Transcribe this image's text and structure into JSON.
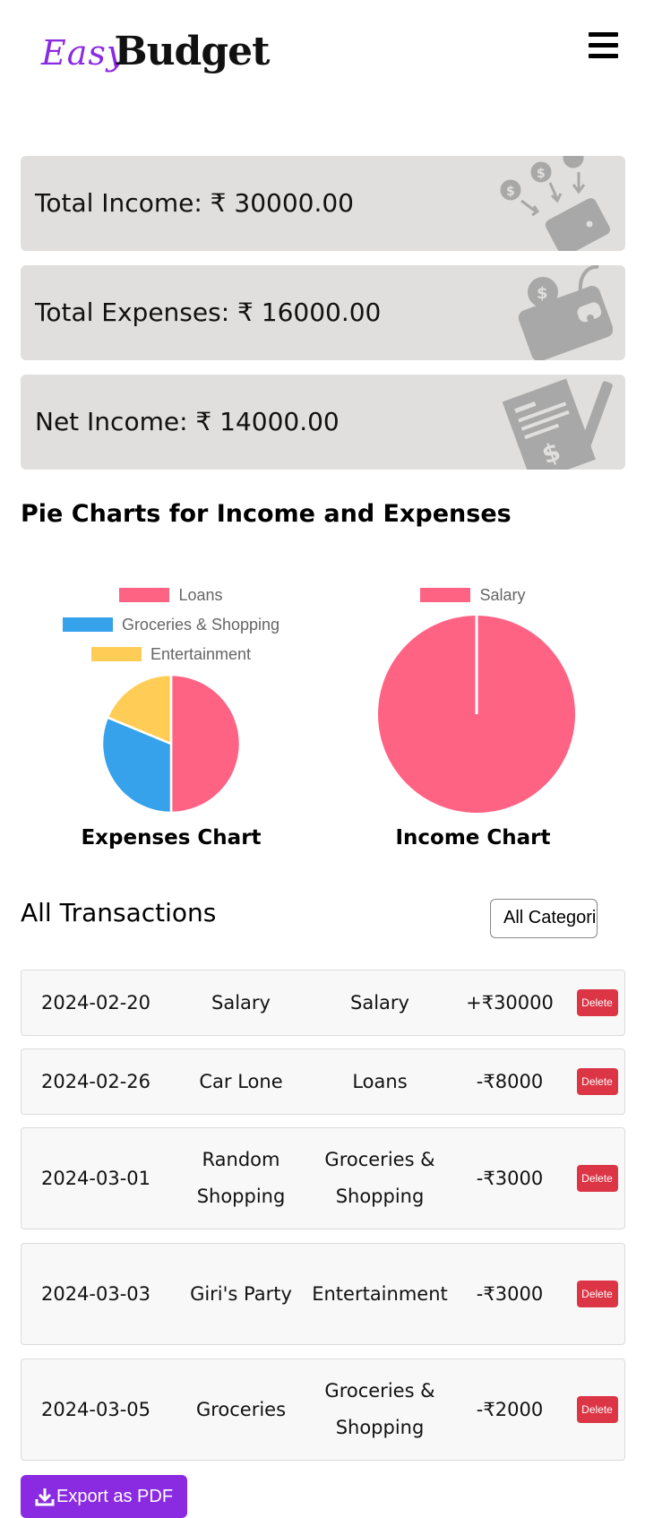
{
  "header": {
    "logo_easy": "Easy",
    "logo_budget": "Budget"
  },
  "summary": {
    "income": "Total Income: ₹ 30000.00",
    "expenses": "Total Expenses: ₹ 16000.00",
    "net": "Net Income: ₹ 14000.00"
  },
  "charts_section": {
    "title": "Pie Charts for Income and Expenses"
  },
  "chart_data": [
    {
      "type": "pie",
      "title": "Expenses Chart",
      "categories": [
        "Loans",
        "Groceries & Shopping",
        "Entertainment"
      ],
      "values": [
        8000,
        5000,
        3000
      ],
      "colors": [
        "#ff6384",
        "#36a2eb",
        "#ffcd56"
      ],
      "legend": "top"
    },
    {
      "type": "pie",
      "title": "Income Chart",
      "categories": [
        "Salary"
      ],
      "values": [
        30000
      ],
      "colors": [
        "#ff6384"
      ],
      "legend": "top"
    }
  ],
  "transactions": {
    "title": "All Transactions",
    "filter_value": "All Categories",
    "delete_label": "Delete",
    "rows": [
      {
        "date": "2024-02-20",
        "description": "Salary",
        "category": "Salary",
        "amount": "+₹30000"
      },
      {
        "date": "2024-02-26",
        "description": "Car Lone",
        "category": "Loans",
        "amount": "-₹8000"
      },
      {
        "date": "2024-03-01",
        "description": "Random Shopping",
        "category": "Groceries & Shopping",
        "amount": "-₹3000"
      },
      {
        "date": "2024-03-03",
        "description": "Giri's Party",
        "category": "Entertainment",
        "amount": "-₹3000"
      },
      {
        "date": "2024-03-05",
        "description": "Groceries",
        "category": "Groceries & Shopping",
        "amount": "-₹2000"
      }
    ]
  },
  "export": {
    "label": "Export as PDF"
  },
  "icons": {
    "menu": "hamburger-menu-icon",
    "income": "coins-into-wallet-icon",
    "expenses": "wallet-with-coin-icon",
    "net": "receipt-with-pen-icon",
    "export": "download-icon"
  },
  "colors": {
    "brand": "#8a2be2",
    "card_bg": "#e0dfdd",
    "delete": "#dc3545",
    "icon_gray": "#a8a8a8"
  }
}
